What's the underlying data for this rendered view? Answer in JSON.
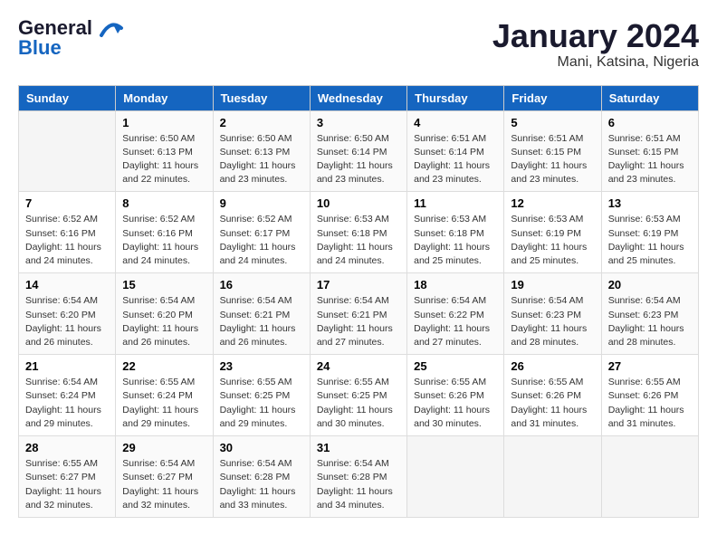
{
  "header": {
    "logo_general": "General",
    "logo_blue": "Blue",
    "title": "January 2024",
    "subtitle": "Mani, Katsina, Nigeria"
  },
  "days_of_week": [
    "Sunday",
    "Monday",
    "Tuesday",
    "Wednesday",
    "Thursday",
    "Friday",
    "Saturday"
  ],
  "weeks": [
    [
      {
        "day": "",
        "info": ""
      },
      {
        "day": "1",
        "info": "Sunrise: 6:50 AM\nSunset: 6:13 PM\nDaylight: 11 hours\nand 22 minutes."
      },
      {
        "day": "2",
        "info": "Sunrise: 6:50 AM\nSunset: 6:13 PM\nDaylight: 11 hours\nand 23 minutes."
      },
      {
        "day": "3",
        "info": "Sunrise: 6:50 AM\nSunset: 6:14 PM\nDaylight: 11 hours\nand 23 minutes."
      },
      {
        "day": "4",
        "info": "Sunrise: 6:51 AM\nSunset: 6:14 PM\nDaylight: 11 hours\nand 23 minutes."
      },
      {
        "day": "5",
        "info": "Sunrise: 6:51 AM\nSunset: 6:15 PM\nDaylight: 11 hours\nand 23 minutes."
      },
      {
        "day": "6",
        "info": "Sunrise: 6:51 AM\nSunset: 6:15 PM\nDaylight: 11 hours\nand 23 minutes."
      }
    ],
    [
      {
        "day": "7",
        "info": "Sunrise: 6:52 AM\nSunset: 6:16 PM\nDaylight: 11 hours\nand 24 minutes."
      },
      {
        "day": "8",
        "info": "Sunrise: 6:52 AM\nSunset: 6:16 PM\nDaylight: 11 hours\nand 24 minutes."
      },
      {
        "day": "9",
        "info": "Sunrise: 6:52 AM\nSunset: 6:17 PM\nDaylight: 11 hours\nand 24 minutes."
      },
      {
        "day": "10",
        "info": "Sunrise: 6:53 AM\nSunset: 6:18 PM\nDaylight: 11 hours\nand 24 minutes."
      },
      {
        "day": "11",
        "info": "Sunrise: 6:53 AM\nSunset: 6:18 PM\nDaylight: 11 hours\nand 25 minutes."
      },
      {
        "day": "12",
        "info": "Sunrise: 6:53 AM\nSunset: 6:19 PM\nDaylight: 11 hours\nand 25 minutes."
      },
      {
        "day": "13",
        "info": "Sunrise: 6:53 AM\nSunset: 6:19 PM\nDaylight: 11 hours\nand 25 minutes."
      }
    ],
    [
      {
        "day": "14",
        "info": "Sunrise: 6:54 AM\nSunset: 6:20 PM\nDaylight: 11 hours\nand 26 minutes."
      },
      {
        "day": "15",
        "info": "Sunrise: 6:54 AM\nSunset: 6:20 PM\nDaylight: 11 hours\nand 26 minutes."
      },
      {
        "day": "16",
        "info": "Sunrise: 6:54 AM\nSunset: 6:21 PM\nDaylight: 11 hours\nand 26 minutes."
      },
      {
        "day": "17",
        "info": "Sunrise: 6:54 AM\nSunset: 6:21 PM\nDaylight: 11 hours\nand 27 minutes."
      },
      {
        "day": "18",
        "info": "Sunrise: 6:54 AM\nSunset: 6:22 PM\nDaylight: 11 hours\nand 27 minutes."
      },
      {
        "day": "19",
        "info": "Sunrise: 6:54 AM\nSunset: 6:23 PM\nDaylight: 11 hours\nand 28 minutes."
      },
      {
        "day": "20",
        "info": "Sunrise: 6:54 AM\nSunset: 6:23 PM\nDaylight: 11 hours\nand 28 minutes."
      }
    ],
    [
      {
        "day": "21",
        "info": "Sunrise: 6:54 AM\nSunset: 6:24 PM\nDaylight: 11 hours\nand 29 minutes."
      },
      {
        "day": "22",
        "info": "Sunrise: 6:55 AM\nSunset: 6:24 PM\nDaylight: 11 hours\nand 29 minutes."
      },
      {
        "day": "23",
        "info": "Sunrise: 6:55 AM\nSunset: 6:25 PM\nDaylight: 11 hours\nand 29 minutes."
      },
      {
        "day": "24",
        "info": "Sunrise: 6:55 AM\nSunset: 6:25 PM\nDaylight: 11 hours\nand 30 minutes."
      },
      {
        "day": "25",
        "info": "Sunrise: 6:55 AM\nSunset: 6:26 PM\nDaylight: 11 hours\nand 30 minutes."
      },
      {
        "day": "26",
        "info": "Sunrise: 6:55 AM\nSunset: 6:26 PM\nDaylight: 11 hours\nand 31 minutes."
      },
      {
        "day": "27",
        "info": "Sunrise: 6:55 AM\nSunset: 6:26 PM\nDaylight: 11 hours\nand 31 minutes."
      }
    ],
    [
      {
        "day": "28",
        "info": "Sunrise: 6:55 AM\nSunset: 6:27 PM\nDaylight: 11 hours\nand 32 minutes."
      },
      {
        "day": "29",
        "info": "Sunrise: 6:54 AM\nSunset: 6:27 PM\nDaylight: 11 hours\nand 32 minutes."
      },
      {
        "day": "30",
        "info": "Sunrise: 6:54 AM\nSunset: 6:28 PM\nDaylight: 11 hours\nand 33 minutes."
      },
      {
        "day": "31",
        "info": "Sunrise: 6:54 AM\nSunset: 6:28 PM\nDaylight: 11 hours\nand 34 minutes."
      },
      {
        "day": "",
        "info": ""
      },
      {
        "day": "",
        "info": ""
      },
      {
        "day": "",
        "info": ""
      }
    ]
  ]
}
